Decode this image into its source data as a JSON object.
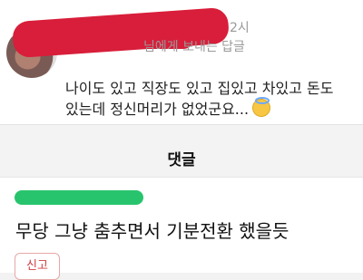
{
  "reply": {
    "time": "2시",
    "reply_to_label": "님에게 보내는 답글",
    "text": "나이도 있고 직장도 있고 집있고 차있고 돈도\n있는데 정신머리가 없었군요..."
  },
  "comments_section": {
    "title": "댓글"
  },
  "comment": {
    "text": "무당 그냥 춤추면서 기분전환 했을듯",
    "report_label": "신고"
  },
  "icons": {
    "reply_emoji": "halo-smile-emoji-icon"
  },
  "colors": {
    "redaction_red": "#d81e3a",
    "redaction_green": "#28c46d",
    "report_red": "#d03d3d"
  }
}
